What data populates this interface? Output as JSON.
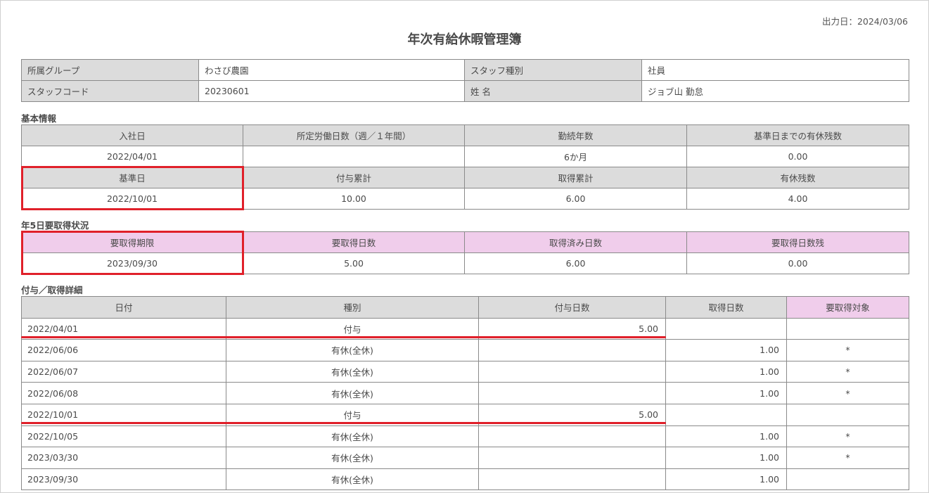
{
  "print_date": "出力日：2024/03/06",
  "title": "年次有給休暇管理簿",
  "header": {
    "group_label": "所属グループ",
    "group_value": "わさび農園",
    "staff_type_label": "スタッフ種別",
    "staff_type_value": "社員",
    "staff_code_label": "スタッフコード",
    "staff_code_value": "20230601",
    "name_label": "姓 名",
    "name_value": "ジョブ山 勤怠"
  },
  "basic": {
    "section": "基本情報",
    "hire_date_label": "入社日",
    "hire_date_value": "2022/04/01",
    "work_days_label": "所定労働日数（週／１年間）",
    "work_days_value": "",
    "tenure_label": "勤続年数",
    "tenure_value": "6か月",
    "remaining_before_label": "基準日までの有休残数",
    "remaining_before_value": "0.00",
    "base_date_label": "基準日",
    "base_date_value": "2022/10/01",
    "granted_total_label": "付与累計",
    "granted_total_value": "10.00",
    "taken_total_label": "取得累計",
    "taken_total_value": "6.00",
    "remaining_label": "有休残数",
    "remaining_value": "4.00"
  },
  "five_day": {
    "section": "年5日要取得状況",
    "deadline_label": "要取得期限",
    "deadline_value": "2023/09/30",
    "required_label": "要取得日数",
    "required_value": "5.00",
    "taken_label": "取得済み日数",
    "taken_value": "6.00",
    "left_label": "要取得日数残",
    "left_value": "0.00"
  },
  "detail": {
    "section": "付与／取得詳細",
    "columns": [
      "日付",
      "種別",
      "付与日数",
      "取得日数",
      "要取得対象"
    ],
    "rows": [
      {
        "date": "2022/04/01",
        "type": "付与",
        "grant": "5.00",
        "taken": "",
        "target": ""
      },
      {
        "date": "2022/06/06",
        "type": "有休(全休)",
        "grant": "",
        "taken": "1.00",
        "target": "*"
      },
      {
        "date": "2022/06/07",
        "type": "有休(全休)",
        "grant": "",
        "taken": "1.00",
        "target": "*"
      },
      {
        "date": "2022/06/08",
        "type": "有休(全休)",
        "grant": "",
        "taken": "1.00",
        "target": "*"
      },
      {
        "date": "2022/10/01",
        "type": "付与",
        "grant": "5.00",
        "taken": "",
        "target": ""
      },
      {
        "date": "2022/10/05",
        "type": "有休(全休)",
        "grant": "",
        "taken": "1.00",
        "target": "*"
      },
      {
        "date": "2023/03/30",
        "type": "有休(全休)",
        "grant": "",
        "taken": "1.00",
        "target": "*"
      },
      {
        "date": "2023/09/30",
        "type": "有休(全休)",
        "grant": "",
        "taken": "1.00",
        "target": ""
      }
    ]
  },
  "colors": {
    "highlight": "#e0202a",
    "label_bg": "#dcdcdc",
    "pink_bg": "#f0cdeb"
  }
}
